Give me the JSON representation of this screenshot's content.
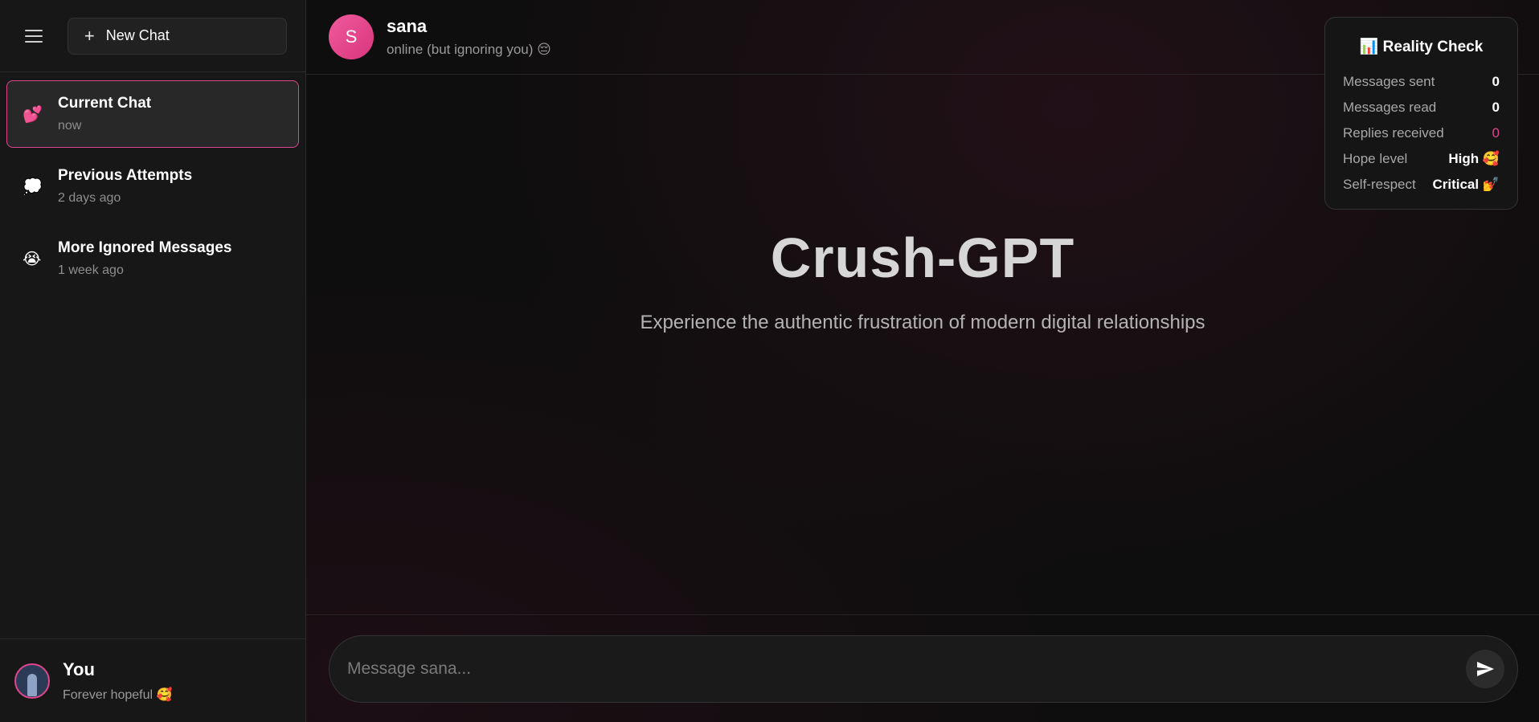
{
  "sidebar": {
    "new_chat_label": "New Chat",
    "chats": [
      {
        "emoji": "💕",
        "title": "Current Chat",
        "time": "now"
      },
      {
        "emoji": "💭",
        "title": "Previous Attempts",
        "time": "2 days ago"
      },
      {
        "emoji": "😭",
        "title": "More Ignored Messages",
        "time": "1 week ago"
      }
    ],
    "user": {
      "name": "You",
      "status": "Forever hopeful 🥰"
    }
  },
  "header": {
    "avatar_letter": "S",
    "contact_name": "sana",
    "contact_status": "online (but ignoring you) 😔"
  },
  "hero": {
    "title": "Crush-GPT",
    "subtitle": "Experience the authentic frustration of modern digital relationships"
  },
  "composer": {
    "placeholder": "Message sana..."
  },
  "reality_check": {
    "title": "📊 Reality Check",
    "rows": [
      {
        "label": "Messages sent",
        "value": "0"
      },
      {
        "label": "Messages read",
        "value": "0"
      },
      {
        "label": "Replies received",
        "value": "0"
      },
      {
        "label": "Hope level",
        "value": "High 🥰"
      },
      {
        "label": "Self-respect",
        "value": "Critical 💅"
      }
    ]
  },
  "colors": {
    "accent": "#e0468f",
    "sidebar_bg": "#171717",
    "main_bg": "#0e0e0e"
  }
}
